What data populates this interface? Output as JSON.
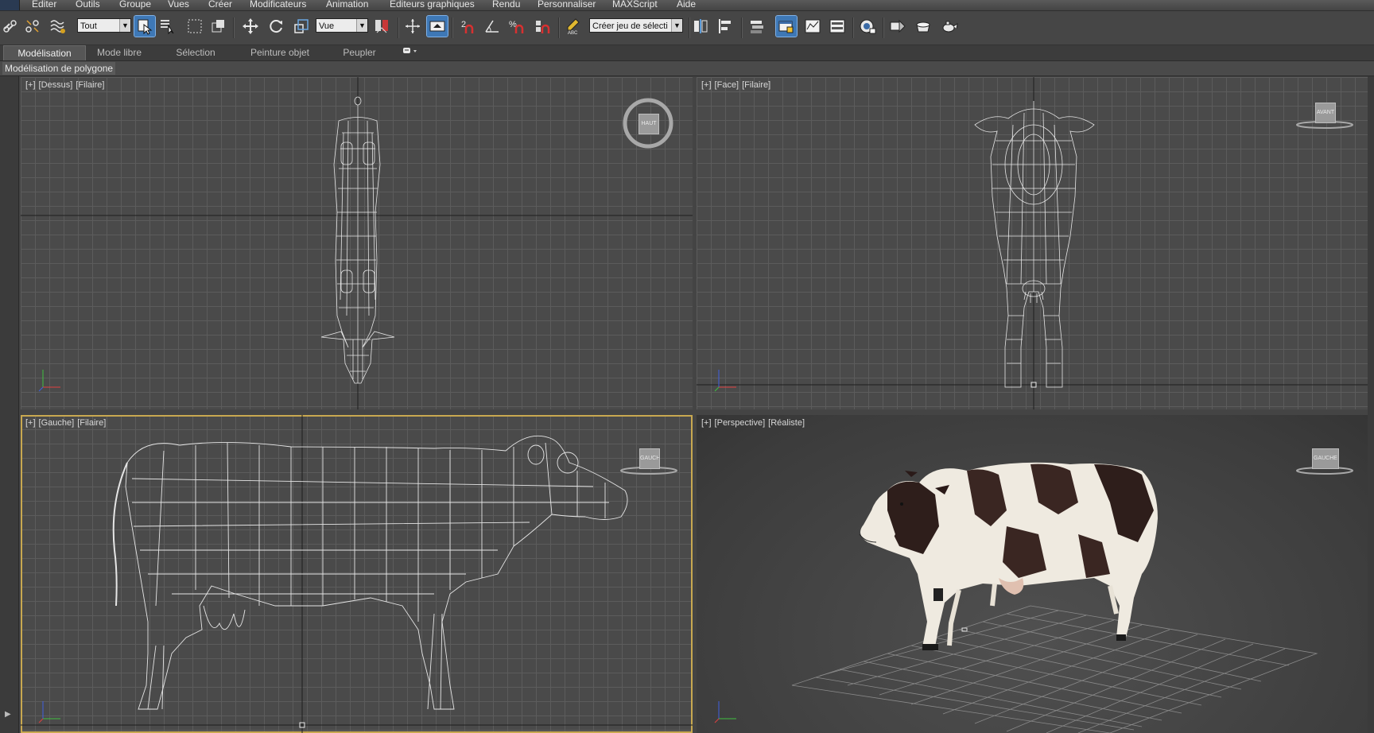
{
  "menu": {
    "items": [
      "Editer",
      "Outils",
      "Groupe",
      "Vues",
      "Créer",
      "Modificateurs",
      "Animation",
      "Editeurs graphiques",
      "Rendu",
      "Personnaliser",
      "MAXScript",
      "Aide"
    ]
  },
  "toolbar": {
    "filter_value": "Tout",
    "ref_coord_value": "Vue",
    "named_selection_placeholder": "Créer jeu de sélecti"
  },
  "ribbon": {
    "tabs": [
      "Modélisation",
      "Mode libre",
      "Sélection",
      "Peinture objet",
      "Peupler"
    ],
    "active_tab": "Modélisation",
    "sub_label": "Modélisation de polygone"
  },
  "viewports": {
    "top": {
      "plus": "[+]",
      "view": "[Dessus]",
      "mode": "[Filaire]",
      "cube_label": "HAUT"
    },
    "front": {
      "plus": "[+]",
      "view": "[Face]",
      "mode": "[Filaire]",
      "cube_label": "AVANT"
    },
    "left": {
      "plus": "[+]",
      "view": "[Gauche]",
      "mode": "[Filaire]",
      "cube_label": "GAUCHE"
    },
    "perspective": {
      "plus": "[+]",
      "view": "[Perspective]",
      "mode": "[Réaliste]",
      "cube_label": "GAUCHE"
    }
  },
  "colors": {
    "accent": "#3e78b6",
    "selected_viewport_border": "#c8a850",
    "viewport_bg": "#4a4a4a",
    "grid_line": "#5c5c5c",
    "wireframe": "#e6e6e6"
  },
  "icons": {
    "toolbar": [
      "link-icon",
      "unlink-icon",
      "bind-space-warp-icon",
      "select-object-icon",
      "select-by-name-icon",
      "rect-selection-region-icon",
      "window-crossing-icon",
      "move-icon",
      "rotate-icon",
      "scale-icon",
      "pivot-center-icon",
      "manipulate-icon",
      "snap-2d-icon",
      "angle-snap-icon",
      "percent-snap-icon",
      "spinner-snap-icon",
      "edit-named-sets-icon",
      "mirror-icon",
      "align-icon",
      "toggle-layer-explorer-icon",
      "layer-manager-icon",
      "graphite-icon",
      "curve-editor-icon",
      "schematic-view-icon",
      "material-editor-icon",
      "render-setup-icon",
      "rendered-frame-window-icon",
      "render-production-icon"
    ]
  }
}
